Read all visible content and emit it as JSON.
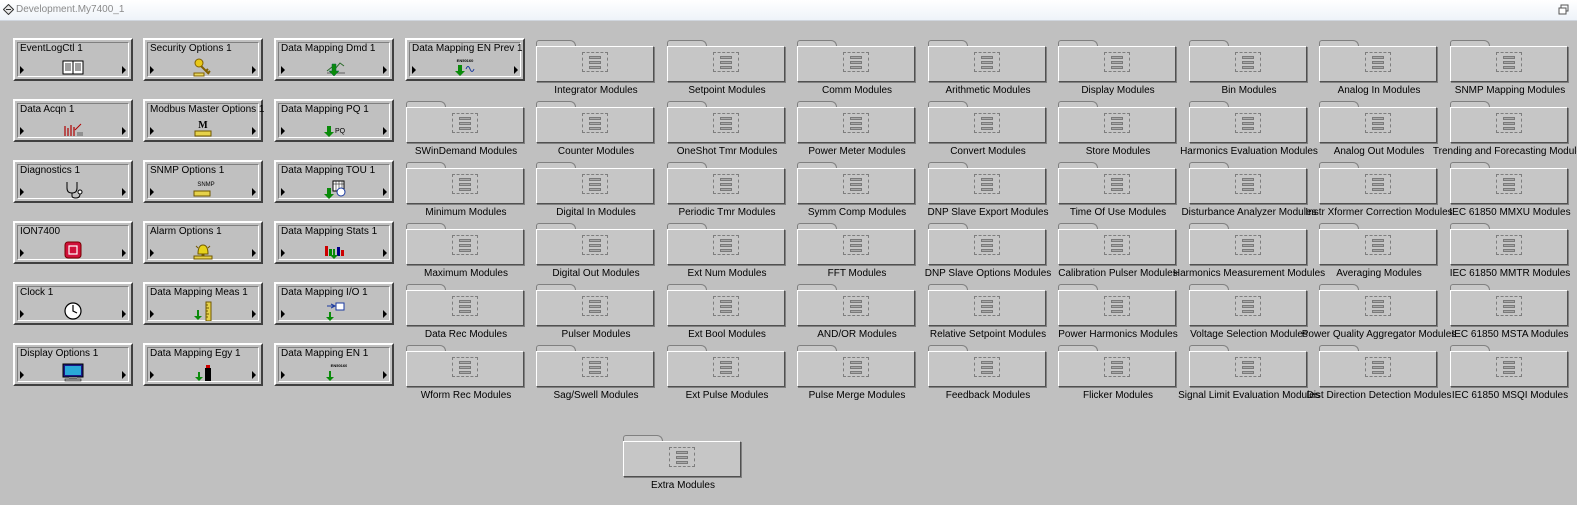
{
  "window": {
    "title": "Development.My7400_1"
  },
  "core_modules": [
    {
      "label": "EventLogCtl 1",
      "icon": "book-icon"
    },
    {
      "label": "Security Options 1",
      "icon": "key-icon"
    },
    {
      "label": "Data Mapping Dmd 1",
      "icon": "demand-graph-icon"
    },
    {
      "label": "Data Mapping EN Prev 1",
      "icon": "en50160-prev-icon"
    },
    {
      "label": "Data Acqn 1",
      "icon": "waveform-acquisition-icon"
    },
    {
      "label": "Modbus Master Options 1",
      "icon": "modbus-icon"
    },
    {
      "label": "Data Mapping PQ 1",
      "icon": "pq-arrow-icon"
    },
    {
      "label": "Diagnostics 1",
      "icon": "stethoscope-icon"
    },
    {
      "label": "SNMP Options 1",
      "icon": "snmp-icon"
    },
    {
      "label": "Data Mapping TOU 1",
      "icon": "tou-calendar-icon"
    },
    {
      "label": "ION7400",
      "icon": "ion-device-icon"
    },
    {
      "label": "Alarm Options 1",
      "icon": "alarm-bell-icon"
    },
    {
      "label": "Data Mapping Stats 1",
      "icon": "stats-bars-icon"
    },
    {
      "label": "Clock 1",
      "icon": "clock-icon"
    },
    {
      "label": "Data Mapping Meas 1",
      "icon": "measurement-ruler-icon"
    },
    {
      "label": "Data Mapping I/O 1",
      "icon": "io-arrows-icon"
    },
    {
      "label": "Display Options 1",
      "icon": "monitor-icon"
    },
    {
      "label": "Data Mapping Egy 1",
      "icon": "energy-battery-icon"
    },
    {
      "label": "Data Mapping EN 1",
      "icon": "en50160-icon"
    }
  ],
  "folders": [
    "Integrator Modules",
    "Setpoint Modules",
    "Comm Modules",
    "Arithmetic Modules",
    "Display Modules",
    "Bin Modules",
    "Analog In Modules",
    "SNMP Mapping Modules",
    "SWinDemand Modules",
    "Counter Modules",
    "OneShot Tmr Modules",
    "Power Meter Modules",
    "Convert Modules",
    "Store Modules",
    "Harmonics Evaluation Modules",
    "Analog Out Modules",
    "Trending and Forecasting Modules",
    "Minimum Modules",
    "Digital In Modules",
    "Periodic Tmr Modules",
    "Symm Comp Modules",
    "DNP Slave Export Modules",
    "Time Of Use Modules",
    "Disturbance Analyzer Modules",
    "Instr Xformer Correction Modules",
    "IEC 61850 MMXU Modules",
    "Maximum Modules",
    "Digital Out Modules",
    "Ext Num Modules",
    "FFT Modules",
    "DNP Slave Options Modules",
    "Calibration Pulser Modules",
    "Harmonics Measurement Modules",
    "Averaging Modules",
    "IEC 61850 MMTR Modules",
    "Data Rec Modules",
    "Pulser Modules",
    "Ext Bool Modules",
    "AND/OR Modules",
    "Relative Setpoint Modules",
    "Power Harmonics Modules",
    "Voltage Selection Modules",
    "Power Quality Aggregator Modules",
    "IEC 61850 MSTA Modules",
    "Wform Rec Modules",
    "Sag/Swell Modules",
    "Ext Pulse Modules",
    "Pulse Merge Modules",
    "Feedback Modules",
    "Flicker Modules",
    "Signal Limit Evaluation Modules",
    "Dist Direction Detection Modules",
    "IEC 61850 MSQI Modules",
    "Extra Modules"
  ],
  "icons": {
    "app": "diamond-app-icon",
    "restore": "restore-icon",
    "folder": "module-folder-icon"
  },
  "colors": {
    "background": "#c0c0c0",
    "arrow_green": "#0a8a0a",
    "ion_red": "#d0103a",
    "bell_yellow": "#e6d21a"
  }
}
